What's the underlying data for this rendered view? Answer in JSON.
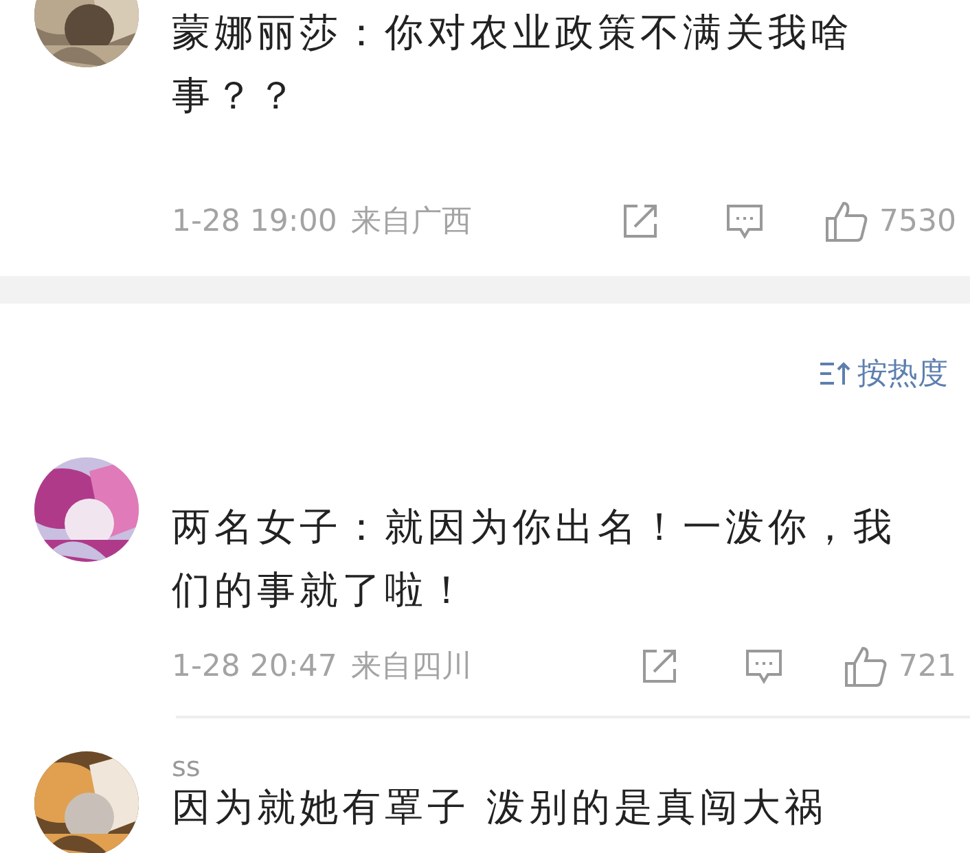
{
  "comments": [
    {
      "avatar": {
        "kind": "picture"
      },
      "text_lines": [
        "蒙娜丽莎：你对农业政策不满关我啥",
        "事？？"
      ],
      "time": "1-28 19:00",
      "location": "来自广西",
      "likes": "7530"
    },
    {
      "avatar": {
        "kind": "picture"
      },
      "text_lines": [
        "两名女子：就因为你出名！一泼你，我",
        "们的事就了啦！"
      ],
      "time": "1-28 20:47",
      "location": "来自四川",
      "likes": "721"
    },
    {
      "avatar": {
        "kind": "picture"
      },
      "username": "ss",
      "text_lines": [
        "因为就她有罩子 泼别的是真闯大祸"
      ]
    }
  ],
  "sort": {
    "label": "按热度"
  }
}
